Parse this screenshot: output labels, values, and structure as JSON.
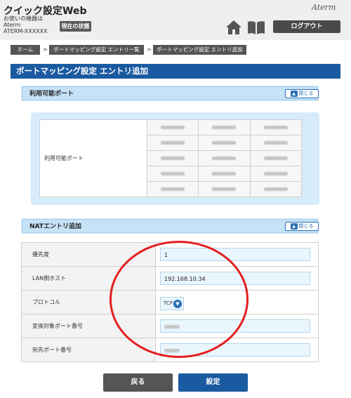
{
  "header": {
    "app_title": "クイック設定Web",
    "device_label": "お使いの機器は",
    "device_name": "Aterm",
    "device_model": "ATERM-XXXXXX",
    "status_button": "現在の状態",
    "brand_logo": "Aterm",
    "logout_button": "ログアウト",
    "icons": [
      "home-icon",
      "book-icon"
    ]
  },
  "breadcrumb": {
    "items": [
      "ホーム",
      "ポートマッピング設定 エントリ一覧",
      "ポートマッピング設定 エントリ追加"
    ],
    "separator": ">"
  },
  "page_title": "ポートマッピング設定 エントリ追加",
  "available_ports": {
    "section_title": "利用可能ポート",
    "close_label": "閉じる",
    "row_label": "利用可能ポート",
    "blurred_cells": 15
  },
  "nat_entry": {
    "section_title": "NATエントリ追加",
    "close_label": "閉じる",
    "fields": [
      {
        "label": "優先度",
        "value": "1"
      },
      {
        "label": "LAN側ホスト",
        "value": "192.168.10.34"
      },
      {
        "label": "プロトコル",
        "value": "TCP"
      },
      {
        "label": "変換対象ポート番号",
        "value": ""
      },
      {
        "label": "宛先ポート番号",
        "value": ""
      }
    ]
  },
  "actions": {
    "back": "戻る",
    "submit": "設定"
  },
  "colors": {
    "primary": "#1a5aa0",
    "panel_bg": "#d7ecfa",
    "annotation": "#e41e1e",
    "header_bg": "#efefef"
  }
}
